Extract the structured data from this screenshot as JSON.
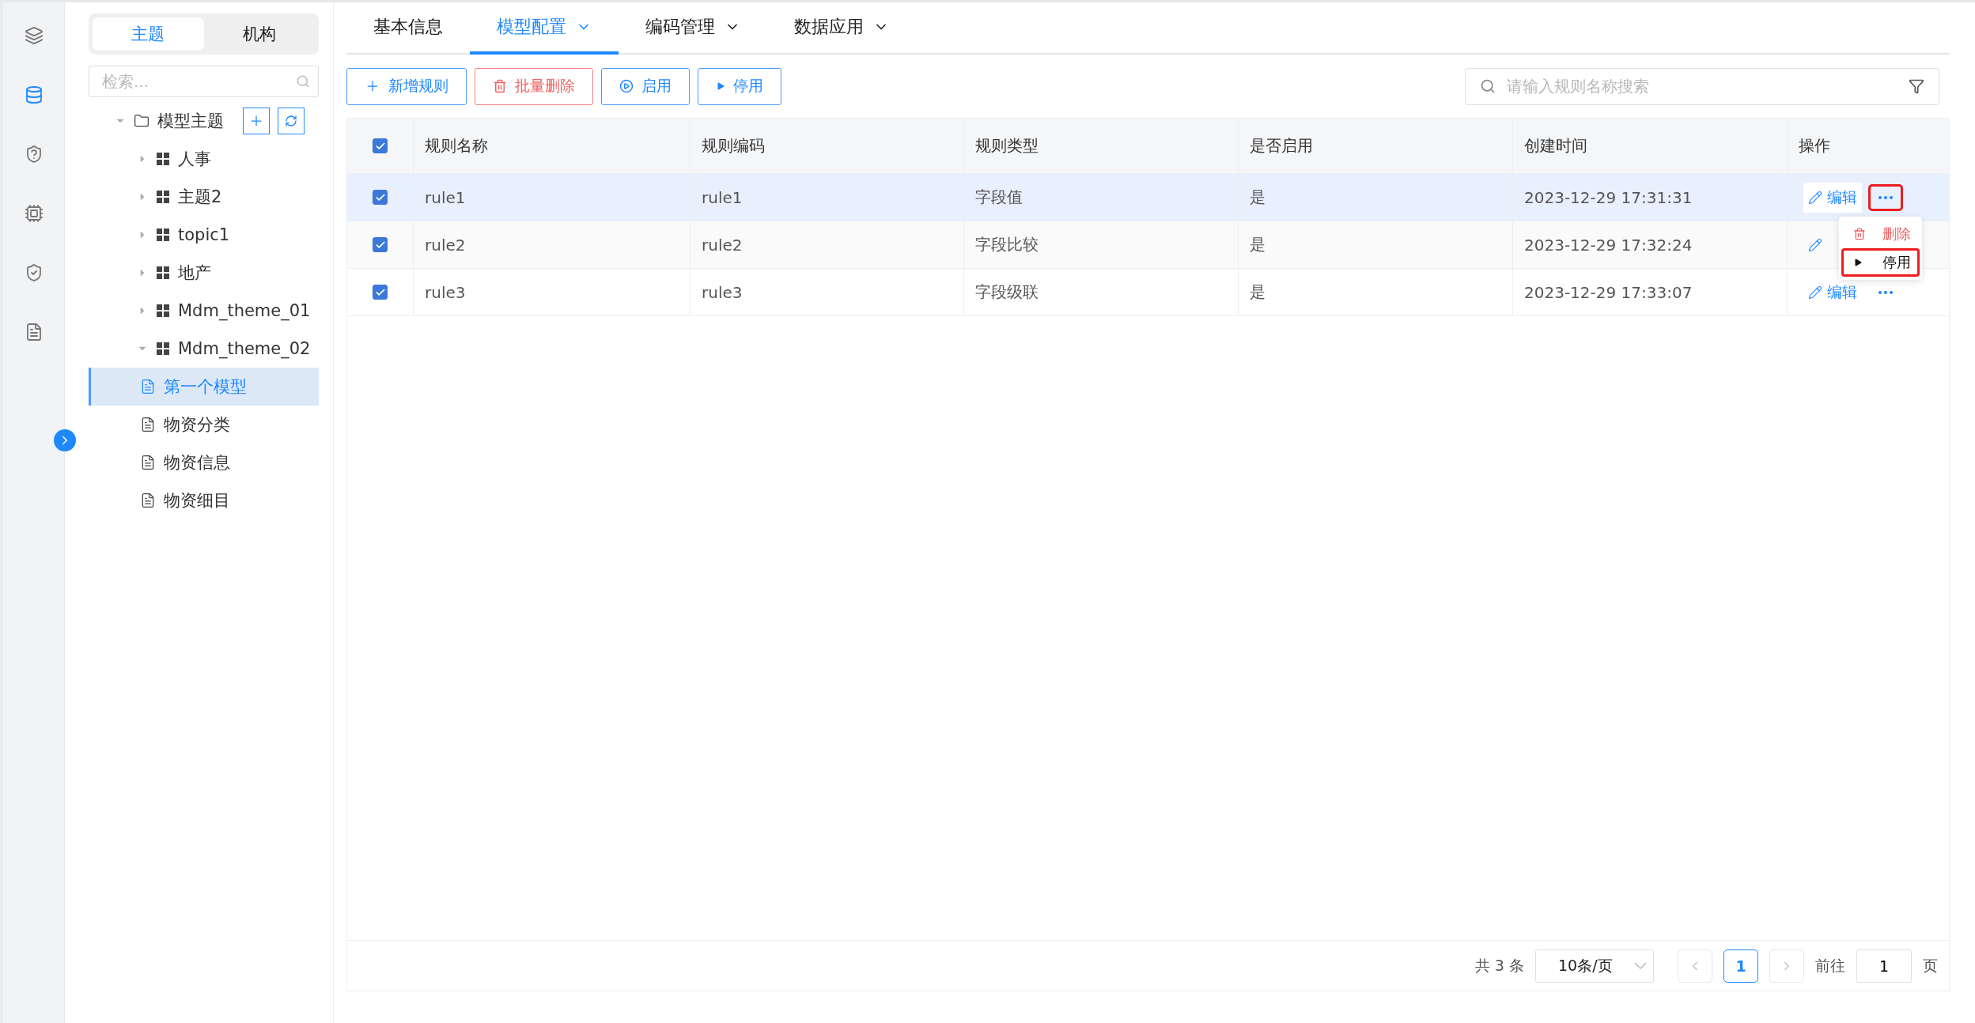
{
  "rail": {
    "items": [
      {
        "kind": "layers",
        "selected": false
      },
      {
        "kind": "database",
        "selected": true
      },
      {
        "kind": "shield-key",
        "selected": false
      },
      {
        "kind": "chip",
        "selected": false
      },
      {
        "kind": "shield-search",
        "selected": false
      },
      {
        "kind": "document",
        "selected": false
      }
    ]
  },
  "tree_panel": {
    "segments": [
      {
        "label": "主题",
        "selected": true
      },
      {
        "label": "机构",
        "selected": false
      }
    ],
    "search": {
      "placeholder": "检索..."
    },
    "tree": {
      "label": "模型主题",
      "expanded": true,
      "selected": false,
      "children": [
        {
          "label": "人事",
          "expanded": false,
          "selected": false
        },
        {
          "label": "主题2",
          "expanded": false,
          "selected": false
        },
        {
          "label": "topic1",
          "expanded": false,
          "selected": false
        },
        {
          "label": "地产",
          "expanded": false,
          "selected": false
        },
        {
          "label": "Mdm_theme_01",
          "expanded": false,
          "selected": false
        },
        {
          "label": "Mdm_theme_02",
          "expanded": true,
          "selected": false,
          "children": [
            {
              "label": "第一个模型",
              "selected": true
            },
            {
              "label": "物资分类",
              "selected": false
            },
            {
              "label": "物资信息",
              "selected": false
            },
            {
              "label": "物资细目",
              "selected": false
            }
          ]
        }
      ]
    }
  },
  "tabs": [
    {
      "label": "基本信息",
      "selected": false,
      "dropdown": false
    },
    {
      "label": "模型配置",
      "selected": true,
      "dropdown": true
    },
    {
      "label": "编码管理",
      "selected": false,
      "dropdown": true
    },
    {
      "label": "数据应用",
      "selected": false,
      "dropdown": true
    }
  ],
  "toolbar": {
    "buttons": [
      {
        "label": "新增规则",
        "kind": "add"
      },
      {
        "label": "批量删除",
        "kind": "delete"
      },
      {
        "label": "启用",
        "kind": "enable"
      },
      {
        "label": "停用",
        "kind": "disable"
      }
    ],
    "search": {
      "placeholder": "请输入规则名称搜索"
    }
  },
  "table": {
    "header_checked": true,
    "columns": [
      "规则名称",
      "规则编码",
      "规则类型",
      "是否启用",
      "创建时间",
      "操作"
    ],
    "rows": [
      {
        "checked": true,
        "selected": true,
        "cells": [
          "rule1",
          "rule1",
          "字段值",
          "是",
          "2023-12-29 17:31:31"
        ],
        "edit_label": "编辑",
        "more_highlighted": true
      },
      {
        "checked": true,
        "selected": false,
        "cells": [
          "rule2",
          "rule2",
          "字段比较",
          "是",
          "2023-12-29 17:32:24"
        ]
      },
      {
        "checked": true,
        "selected": false,
        "cells": [
          "rule3",
          "rule3",
          "字段级联",
          "是",
          "2023-12-29 17:33:07"
        ],
        "edit_label": "编辑",
        "more_highlighted": false
      }
    ]
  },
  "menu": {
    "items": [
      {
        "label": "删除",
        "kind": "danger",
        "highlighted": false
      },
      {
        "label": "停用",
        "kind": "disable",
        "highlighted": true
      }
    ]
  },
  "pagination": {
    "total": "共 3 条",
    "page_size": "10条/页",
    "pages": [
      {
        "label": "1",
        "selected": true
      }
    ],
    "goto_label": "前往",
    "goto_value": "1",
    "page_suffix": "页"
  }
}
